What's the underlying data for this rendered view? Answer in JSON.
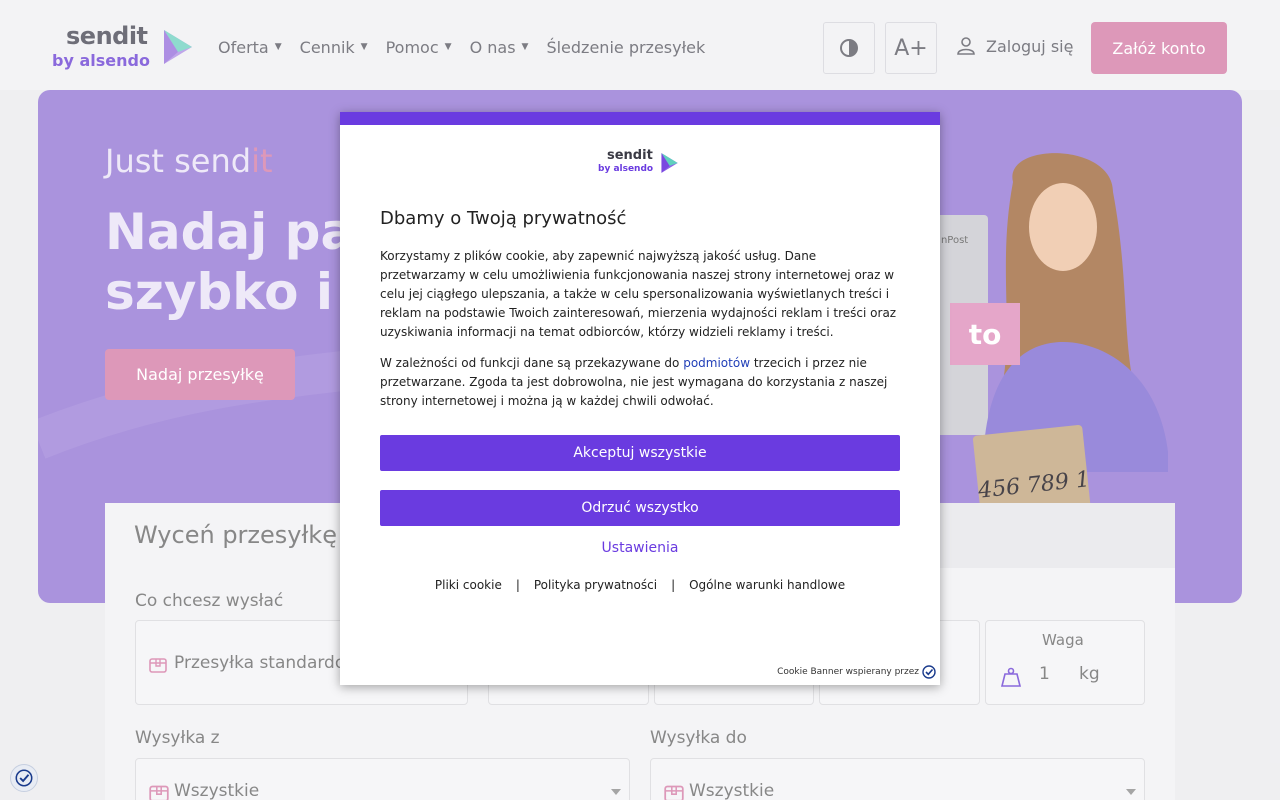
{
  "header": {
    "logo_main": "sendit",
    "logo_sub": "by alsendo",
    "nav": [
      {
        "label": "Oferta",
        "has_dropdown": true
      },
      {
        "label": "Cennik",
        "has_dropdown": true
      },
      {
        "label": "Pomoc",
        "has_dropdown": true
      },
      {
        "label": "O nas",
        "has_dropdown": true
      },
      {
        "label": "Śledzenie przesyłek",
        "has_dropdown": false
      }
    ],
    "font_size_label": "A+",
    "login_label": "Zaloguj się",
    "register_label": "Załóż konto"
  },
  "hero": {
    "tagline_prefix": "Just send",
    "tagline_accent": "it",
    "title_line1": "Nadaj paczkę",
    "title_line2": "szybko i wygodnie",
    "cta_label": "Nadaj przesyłkę",
    "locker_label": "InPost",
    "promo_tag": "to",
    "box_text": "456 789 1"
  },
  "pricing": {
    "title": "Wyceń przesyłkę",
    "what_label": "Co chcesz wysłać",
    "what_value": "Przesyłka standardowa",
    "weight_label": "Waga",
    "weight_value": "1",
    "weight_unit": "kg",
    "from_label": "Wysyłka z",
    "from_value": "Wszystkie",
    "to_label": "Wysyłka do",
    "to_value": "Wszystkie"
  },
  "cookie_modal": {
    "logo_main": "sendit",
    "logo_sub": "by alsendo",
    "title": "Dbamy o Twoją prywatność",
    "paragraph1": "Korzystamy z plików cookie, aby zapewnić najwyższą jakość usług. Dane przetwarzamy w celu umożliwienia funkcjonowania naszej strony internetowej oraz w celu jej ciągłego ulepszania, a także w celu spersonalizowania wyświetlanych treści i reklam na podstawie Twoich zainteresowań, mierzenia wydajności reklam i treści oraz uzyskiwania informacji na temat odbiorców, którzy widzieli reklamy i treści.",
    "paragraph2_before": "W zależności od funkcji dane są przekazywane do ",
    "paragraph2_link": "podmiotów",
    "paragraph2_after": " trzecich i przez nie przetwarzane. Zgoda ta jest dobrowolna, nie jest wymagana do korzystania z naszej strony internetowej i można ją w każdej chwili odwołać.",
    "accept_label": "Akceptuj wszystkie",
    "reject_label": "Odrzuć wszystko",
    "settings_label": "Ustawienia",
    "footer_links": [
      "Pliki cookie",
      "Polityka prywatności",
      "Ogólne warunki handlowe"
    ],
    "footer_separator": "|",
    "powered_by": "Cookie Banner wspierany przez"
  },
  "colors": {
    "brand_purple": "#6a3be0",
    "hero_bg": "#9f85d9",
    "accent_pink": "#d98ab0"
  }
}
